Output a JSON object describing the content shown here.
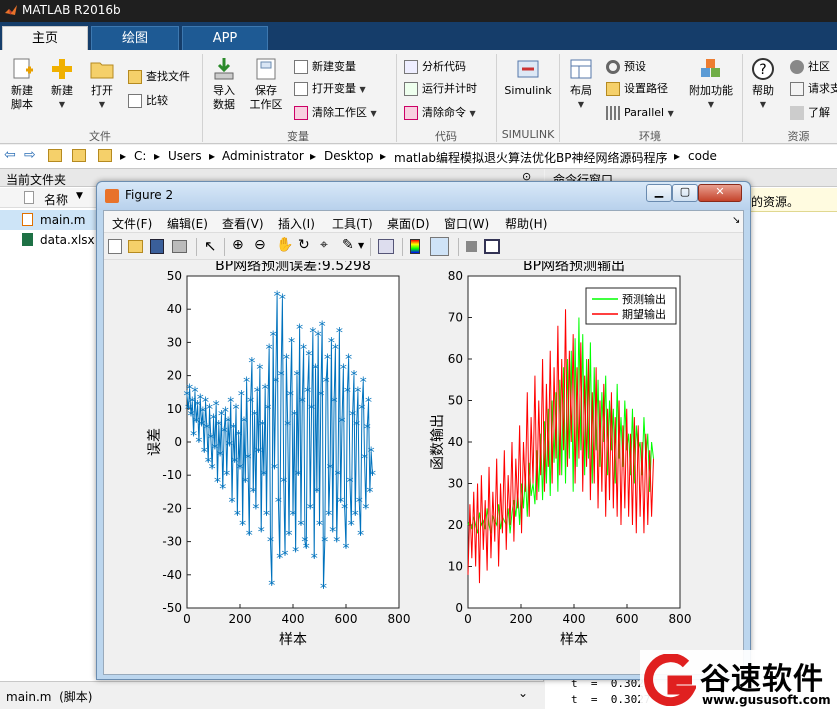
{
  "app": {
    "title": "MATLAB R2016b"
  },
  "tabs": [
    {
      "label": "主页"
    },
    {
      "label": "绘图"
    },
    {
      "label": "APP"
    }
  ],
  "ribbon": {
    "new_script": "新建\n脚本",
    "new": "新建",
    "open": "打开",
    "find_files": "查找文件",
    "compare": "比较",
    "import_data": "导入\n数据",
    "save_workspace": "保存\n工作区",
    "new_variable": "新建变量",
    "open_variable": "打开变量",
    "clear_workspace": "清除工作区",
    "analyze_code": "分析代码",
    "run_and_time": "运行并计时",
    "clear_commands": "清除命令",
    "simulink": "Simulink",
    "layout": "布局",
    "preferences": "预设",
    "set_path": "设置路径",
    "parallel": "Parallel",
    "addons": "附加功能",
    "help": "帮助",
    "community": "社区",
    "request_support": "请求支",
    "learn": "了解",
    "groups": {
      "file": "文件",
      "variable": "变量",
      "code": "代码",
      "simulink": "SIMULINK",
      "environment": "环境",
      "resources": "资源"
    }
  },
  "address": {
    "drive": "C:",
    "path": [
      "Users",
      "Administrator",
      "Desktop",
      "matlab编程模拟退火算法优化BP神经网络源码程序",
      "code"
    ]
  },
  "current_folder": {
    "title": "当前文件夹",
    "column": "名称",
    "files": [
      "main.m",
      "data.xlsx"
    ],
    "details": "main.m  (脚本)"
  },
  "command_window": {
    "title": "命令行窗口",
    "notice_tail": "的资源。",
    "lines": [
      "t  =  0.302",
      "t  =  0.3027"
    ]
  },
  "figure": {
    "title": "Figure 2",
    "menus": [
      "文件(F)",
      "编辑(E)",
      "查看(V)",
      "插入(I)",
      "工具(T)",
      "桌面(D)",
      "窗口(W)",
      "帮助(H)"
    ]
  },
  "chart_data": [
    {
      "type": "line",
      "title": "BP网络预测误差:9.5298",
      "xlabel": "样本",
      "ylabel": "误差",
      "xlim": [
        0,
        800
      ],
      "ylim": [
        -50,
        50
      ],
      "xticks": [
        0,
        200,
        400,
        600,
        800
      ],
      "yticks": [
        -50,
        -40,
        -30,
        -20,
        -10,
        0,
        10,
        20,
        30,
        40,
        50
      ],
      "marker": "*",
      "color": "#0072bd",
      "series": [
        {
          "values": [
            [
              0,
              14
            ],
            [
              5,
              10
            ],
            [
              10,
              16
            ],
            [
              15,
              8
            ],
            [
              20,
              12
            ],
            [
              25,
              2
            ],
            [
              30,
              15
            ],
            [
              35,
              6
            ],
            [
              40,
              11
            ],
            [
              45,
              0
            ],
            [
              50,
              13
            ],
            [
              55,
              5
            ],
            [
              60,
              9
            ],
            [
              65,
              -3
            ],
            [
              70,
              12
            ],
            [
              75,
              4
            ],
            [
              80,
              -6
            ],
            [
              85,
              10
            ],
            [
              90,
              1
            ],
            [
              95,
              -8
            ],
            [
              100,
              7
            ],
            [
              105,
              -2
            ],
            [
              110,
              11
            ],
            [
              115,
              -12
            ],
            [
              120,
              5
            ],
            [
              125,
              -4
            ],
            [
              130,
              8
            ],
            [
              135,
              -14
            ],
            [
              140,
              3
            ],
            [
              145,
              9
            ],
            [
              150,
              -10
            ],
            [
              155,
              6
            ],
            [
              160,
              -1
            ],
            [
              165,
              12
            ],
            [
              170,
              -18
            ],
            [
              175,
              4
            ],
            [
              180,
              -6
            ],
            [
              185,
              10
            ],
            [
              190,
              -22
            ],
            [
              195,
              2
            ],
            [
              200,
              -8
            ],
            [
              205,
              14
            ],
            [
              210,
              -25
            ],
            [
              215,
              6
            ],
            [
              220,
              -12
            ],
            [
              225,
              18
            ],
            [
              230,
              -5
            ],
            [
              235,
              -28
            ],
            [
              240,
              12
            ],
            [
              245,
              24
            ],
            [
              250,
              -15
            ],
            [
              255,
              8
            ],
            [
              260,
              -20
            ],
            [
              265,
              15
            ],
            [
              270,
              -3
            ],
            [
              275,
              22
            ],
            [
              280,
              -27
            ],
            [
              285,
              5
            ],
            [
              290,
              -10
            ],
            [
              295,
              16
            ],
            [
              300,
              -22
            ],
            [
              305,
              10
            ],
            [
              310,
              28
            ],
            [
              315,
              -30
            ],
            [
              320,
              -43
            ],
            [
              325,
              32
            ],
            [
              330,
              -8
            ],
            [
              335,
              18
            ],
            [
              340,
              44
            ],
            [
              345,
              -18
            ],
            [
              350,
              -35
            ],
            [
              355,
              20
            ],
            [
              360,
              43
            ],
            [
              365,
              -12
            ],
            [
              370,
              -34
            ],
            [
              375,
              25
            ],
            [
              380,
              5
            ],
            [
              385,
              -28
            ],
            [
              390,
              14
            ],
            [
              395,
              30
            ],
            [
              400,
              -22
            ],
            [
              405,
              8
            ],
            [
              410,
              -33
            ],
            [
              415,
              20
            ],
            [
              420,
              -10
            ],
            [
              425,
              34
            ],
            [
              430,
              -25
            ],
            [
              435,
              12
            ],
            [
              440,
              28
            ],
            [
              445,
              -30
            ],
            [
              450,
              -32
            ],
            [
              455,
              15
            ],
            [
              460,
              26
            ],
            [
              465,
              -20
            ],
            [
              470,
              10
            ],
            [
              475,
              33
            ],
            [
              480,
              -35
            ],
            [
              485,
              22
            ],
            [
              490,
              -15
            ],
            [
              495,
              32
            ],
            [
              500,
              -25
            ],
            [
              505,
              14
            ],
            [
              510,
              35
            ],
            [
              515,
              -44
            ],
            [
              520,
              -30
            ],
            [
              525,
              18
            ],
            [
              530,
              25
            ],
            [
              535,
              -22
            ],
            [
              540,
              -8
            ],
            [
              545,
              30
            ],
            [
              550,
              -27
            ],
            [
              555,
              12
            ],
            [
              560,
              28
            ],
            [
              565,
              -30
            ],
            [
              570,
              -10
            ],
            [
              575,
              33
            ],
            [
              580,
              -18
            ],
            [
              585,
              6
            ],
            [
              590,
              22
            ],
            [
              595,
              -20
            ],
            [
              600,
              -32
            ],
            [
              605,
              15
            ],
            [
              610,
              25
            ],
            [
              615,
              -12
            ],
            [
              620,
              -25
            ],
            [
              625,
              8
            ],
            [
              630,
              20
            ],
            [
              635,
              -22
            ],
            [
              640,
              5
            ],
            [
              645,
              15
            ],
            [
              650,
              -18
            ],
            [
              655,
              -28
            ],
            [
              660,
              10
            ],
            [
              665,
              18
            ],
            [
              670,
              -5
            ],
            [
              675,
              -20
            ],
            [
              680,
              4
            ],
            [
              685,
              12
            ],
            [
              690,
              -15
            ],
            [
              695,
              -3
            ],
            [
              700,
              -10
            ]
          ]
        }
      ]
    },
    {
      "type": "line",
      "title": "BP网络预测输出",
      "xlabel": "样本",
      "ylabel": "函数输出",
      "xlim": [
        0,
        800
      ],
      "ylim": [
        0,
        80
      ],
      "xticks": [
        0,
        200,
        400,
        600,
        800
      ],
      "yticks": [
        0,
        10,
        20,
        30,
        40,
        50,
        60,
        70,
        80
      ],
      "legend_position": "top-right",
      "series": [
        {
          "name": "预测输出",
          "color": "#00ff00",
          "values": [
            20,
            21,
            19,
            22,
            20,
            18,
            23,
            20,
            21,
            19,
            24,
            20,
            18,
            22,
            21,
            20,
            25,
            19,
            22,
            21,
            20,
            24,
            18,
            23,
            26,
            22,
            28,
            20,
            30,
            24,
            32,
            22,
            35,
            27,
            30,
            25,
            38,
            28,
            42,
            26,
            45,
            30,
            48,
            27,
            50,
            35,
            52,
            28,
            55,
            32,
            58,
            30,
            60,
            36,
            62,
            28,
            65,
            34,
            70,
            38,
            66,
            32,
            60,
            36,
            64,
            30,
            58,
            38,
            55,
            34,
            52,
            40,
            56,
            32,
            50,
            38,
            48,
            30,
            54,
            36,
            46,
            34,
            50,
            38,
            42,
            32,
            48,
            30,
            44,
            38,
            40,
            32,
            46,
            36,
            42,
            28,
            40,
            36
          ]
        },
        {
          "name": "期望输出",
          "color": "#ff0000",
          "values": [
            8,
            25,
            12,
            28,
            10,
            30,
            6,
            32,
            14,
            26,
            9,
            34,
            12,
            28,
            16,
            36,
            10,
            30,
            18,
            38,
            14,
            32,
            20,
            40,
            16,
            36,
            24,
            44,
            18,
            40,
            28,
            52,
            22,
            46,
            30,
            56,
            26,
            50,
            32,
            60,
            28,
            54,
            34,
            62,
            30,
            58,
            36,
            68,
            32,
            60,
            38,
            72,
            34,
            62,
            40,
            66,
            30,
            58,
            36,
            64,
            28,
            56,
            34,
            60,
            26,
            52,
            30,
            58,
            24,
            50,
            28,
            54,
            22,
            48,
            26,
            52,
            24,
            46,
            22,
            50,
            20,
            44,
            24,
            48,
            22,
            42,
            20,
            46,
            18,
            44,
            22,
            40,
            18,
            42,
            20,
            38,
            22,
            36
          ]
        }
      ]
    }
  ],
  "watermark": {
    "brand": "谷速软件",
    "url": "www.gususoft.com"
  }
}
